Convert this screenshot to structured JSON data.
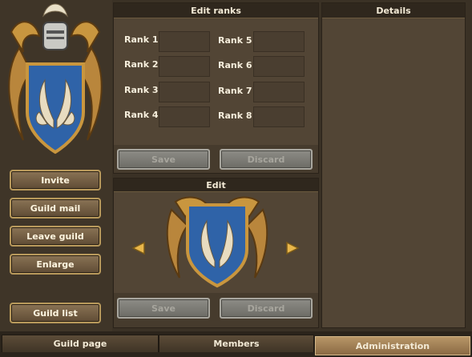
{
  "edit_ranks": {
    "title": "Edit ranks",
    "ranks": [
      "Rank 1",
      "Rank 2",
      "Rank 3",
      "Rank 4",
      "Rank 5",
      "Rank 6",
      "Rank 7",
      "Rank 8"
    ],
    "save_label": "Save",
    "discard_label": "Discard"
  },
  "edit": {
    "title": "Edit",
    "save_label": "Save",
    "discard_label": "Discard"
  },
  "details": {
    "title": "Details"
  },
  "guild_buttons": {
    "invite": "Invite",
    "guild_mail": "Guild mail",
    "leave_guild": "Leave guild",
    "enlarge": "Enlarge",
    "guild_list": "Guild list"
  },
  "tabs": [
    "Guild page",
    "Members",
    "Administration"
  ],
  "active_tab": "Administration",
  "crest": {
    "shield_color": "#2f63a8",
    "emblem": "wings-icon"
  }
}
